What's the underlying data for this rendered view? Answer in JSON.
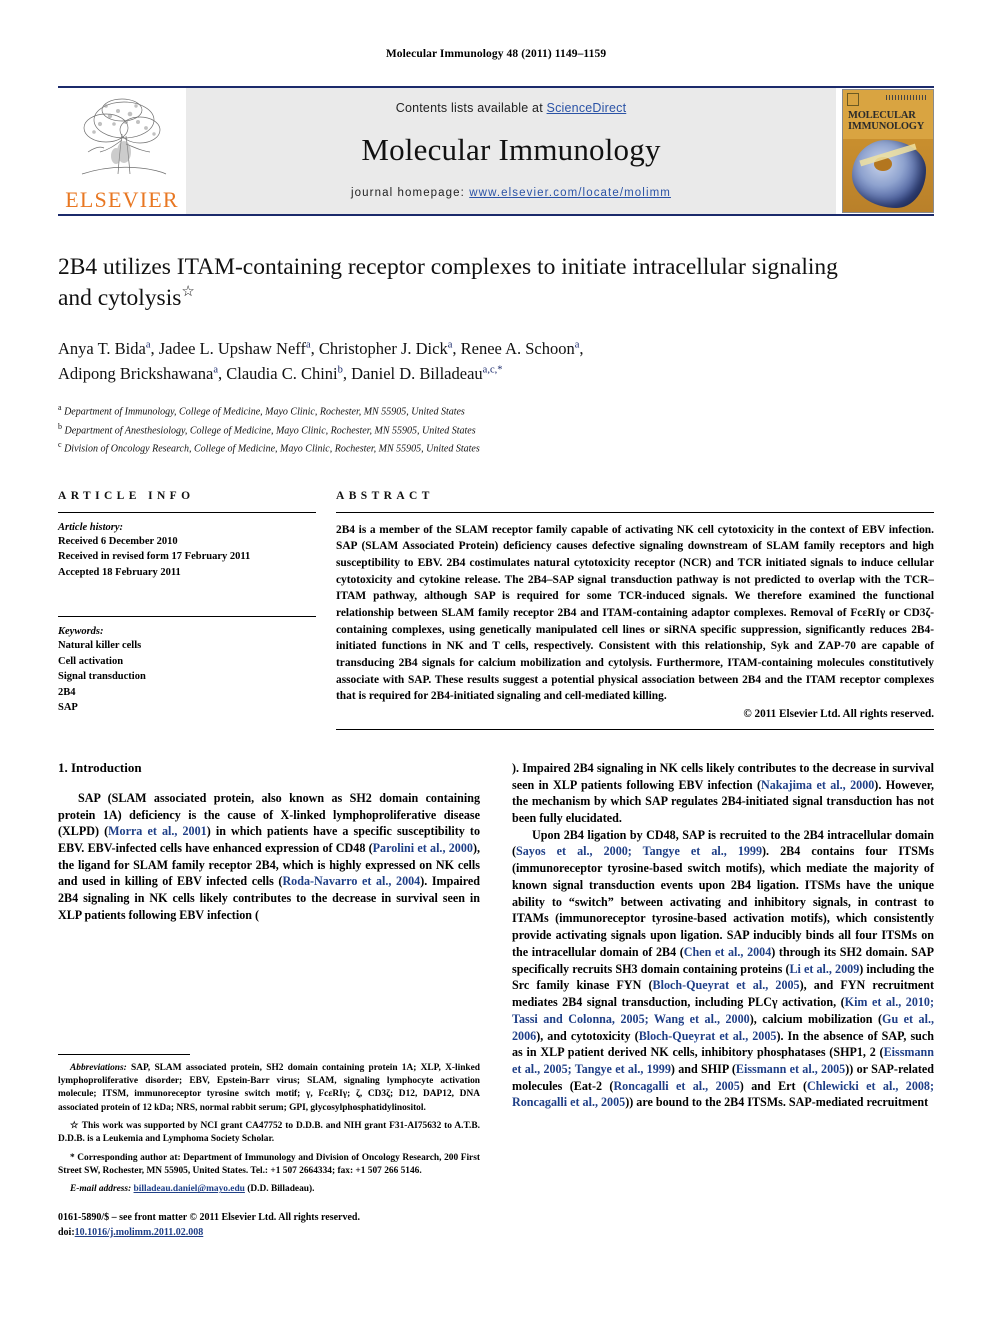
{
  "running_head": "Molecular Immunology 48 (2011) 1149–1159",
  "masthead": {
    "publisher_name": "ELSEVIER",
    "contents_prefix": "Contents lists available at ",
    "contents_link": "ScienceDirect",
    "journal_name": "Molecular Immunology",
    "homepage_prefix": "journal homepage: ",
    "homepage_url": "www.elsevier.com/locate/molimm",
    "cover_title_line1": "MOLECULAR",
    "cover_title_line2": "IMMUNOLOGY"
  },
  "article": {
    "title": "2B4 utilizes ITAM-containing receptor complexes to initiate intracellular signaling and cytolysis",
    "title_footnote_mark": "☆",
    "authors_line1": "Anya T. Bida a, Jadee L. Upshaw Neff a, Christopher J. Dick a, Renee A. Schoon a,",
    "authors_line2": "Adipong Brickshawana a, Claudia C. Chini b, Daniel D. Billadeau a,c,*",
    "affiliations": [
      {
        "mark": "a",
        "text": "Department of Immunology, College of Medicine, Mayo Clinic, Rochester, MN 55905, United States"
      },
      {
        "mark": "b",
        "text": "Department of Anesthesiology, College of Medicine, Mayo Clinic, Rochester, MN 55905, United States"
      },
      {
        "mark": "c",
        "text": "Division of Oncology Research, College of Medicine, Mayo Clinic, Rochester, MN 55905, United States"
      }
    ]
  },
  "article_info": {
    "heading": "ARTICLE INFO",
    "history_label": "Article history:",
    "history": [
      "Received 6 December 2010",
      "Received in revised form 17 February 2011",
      "Accepted 18 February 2011"
    ],
    "keywords_label": "Keywords:",
    "keywords": [
      "Natural killer cells",
      "Cell activation",
      "Signal transduction",
      "2B4",
      "SAP"
    ]
  },
  "abstract": {
    "heading": "ABSTRACT",
    "text": "2B4 is a member of the SLAM receptor family capable of activating NK cell cytotoxicity in the context of EBV infection. SAP (SLAM Associated Protein) deficiency causes defective signaling downstream of SLAM family receptors and high susceptibility to EBV. 2B4 costimulates natural cytotoxicity receptor (NCR) and TCR initiated signals to induce cellular cytotoxicity and cytokine release. The 2B4–SAP signal transduction pathway is not predicted to overlap with the TCR–ITAM pathway, although SAP is required for some TCR-induced signals. We therefore examined the functional relationship between SLAM family receptor 2B4 and ITAM-containing adaptor complexes. Removal of FcεRIγ or CD3ζ-containing complexes, using genetically manipulated cell lines or siRNA specific suppression, significantly reduces 2B4-initiated functions in NK and T cells, respectively. Consistent with this relationship, Syk and ZAP-70 are capable of transducing 2B4 signals for calcium mobilization and cytolysis. Furthermore, ITAM-containing molecules constitutively associate with SAP. These results suggest a potential physical association between 2B4 and the ITAM receptor complexes that is required for 2B4-initiated signaling and cell-mediated killing.",
    "copyright": "© 2011 Elsevier Ltd. All rights reserved."
  },
  "introduction": {
    "heading": "1.  Introduction",
    "paragraph_1_parts": [
      "SAP (SLAM associated protein, also known as SH2 domain containing protein 1A) deficiency is the cause of X-linked lymphoproliferative disease (XLPD) (",
      "Morra et al., 2001",
      ") in which patients have a specific susceptibility to EBV. EBV-infected cells have enhanced expression of CD48 (",
      "Parolini et al., 2000",
      "), the ligand for SLAM family receptor 2B4, which is highly expressed on NK cells and used in killing of EBV infected cells (",
      "Roda-Navarro et al., 2004",
      "). Impaired 2B4 signaling in NK cells likely contributes to the decrease in survival seen in XLP patients following EBV infection (",
      "Nakajima et al., 2000",
      "). However, the mechanism by which SAP regulates 2B4-initiated signal transduction has not been fully elucidated."
    ],
    "paragraph_2_parts": [
      "Upon 2B4 ligation by CD48, SAP is recruited to the 2B4 intracellular domain (",
      "Sayos et al., 2000; Tangye et al., 1999",
      "). 2B4 contains four ITSMs (immunoreceptor tyrosine-based switch motifs), which mediate the majority of known signal transduction events upon 2B4 ligation. ITSMs have the unique ability to “switch” between activating and inhibitory signals, in contrast to ITAMs (immunoreceptor tyrosine-based activation motifs), which consistently provide activating signals upon ligation. SAP inducibly binds all four ITSMs on the intracellular domain of 2B4 (",
      "Chen et al., 2004",
      ") through its SH2 domain. SAP specifically recruits SH3 domain containing proteins (",
      "Li et al., 2009",
      ") including the Src family kinase FYN (",
      "Bloch-Queyrat et al., 2005",
      "), and FYN recruitment mediates 2B4 signal transduction, including PLCγ activation, (",
      "Kim et al., 2010; Tassi and Colonna, 2005; Wang et al., 2000",
      "), calcium mobilization (",
      "Gu et al., 2006",
      "), and cytotoxicity (",
      "Bloch-Queyrat et al., 2005",
      "). In the absence of SAP, such as in XLP patient derived NK cells, inhibitory phosphatases (SHP1, 2 (",
      "Eissmann et al., 2005; Tangye et al., 1999",
      ") and SHIP (",
      "Eissmann et al., 2005",
      ")) or SAP-related molecules (Eat-2 (",
      "Roncagalli et al., 2005",
      ") and Ert (",
      "Chlewicki et al., 2008; Roncagalli et al., 2005",
      ")) are bound to the 2B4 ITSMs. SAP-mediated recruitment"
    ]
  },
  "footnotes": {
    "abbreviations_label": "Abbreviations:",
    "abbreviations_text": " SAP, SLAM associated protein, SH2 domain containing protein 1A; XLP, X-linked lymphoproliferative disorder; EBV, Epstein-Barr virus; SLAM, signaling lymphocyte activation molecule; ITSM, immunoreceptor tyrosine switch motif; γ, FcεRIγ; ζ, CD3ζ; D12, DAP12, DNA associated protein of 12 kDa; NRS, normal rabbit serum; GPI, glycosylphosphatidylinositol.",
    "funding_mark": "☆",
    "funding_text": "This work was supported by NCI grant CA47752 to D.D.B. and NIH grant F31-AI75632 to A.T.B. D.D.B. is a Leukemia and Lymphoma Society Scholar.",
    "corresponding_mark": "*",
    "corresponding_text": "Corresponding author at: Department of Immunology and Division of Oncology Research, 200 First Street SW, Rochester, MN 55905, United States. Tel.: +1 507 2664334; fax: +1 507 266 5146.",
    "email_label": "E-mail address:",
    "email": "billadeau.daniel@mayo.edu",
    "email_suffix": " (D.D. Billadeau).",
    "issn_line": "0161-5890/$ – see front matter © 2011 Elsevier Ltd. All rights reserved.",
    "doi_label": "doi:",
    "doi_value": "10.1016/j.molimm.2011.02.008"
  },
  "colors": {
    "link_blue": "#2b53a6",
    "ref_blue": "#1f3f87",
    "rule_navy": "#1b2a6b",
    "elsevier_orange": "#E87722",
    "masthead_gray": "#eaeaea"
  }
}
